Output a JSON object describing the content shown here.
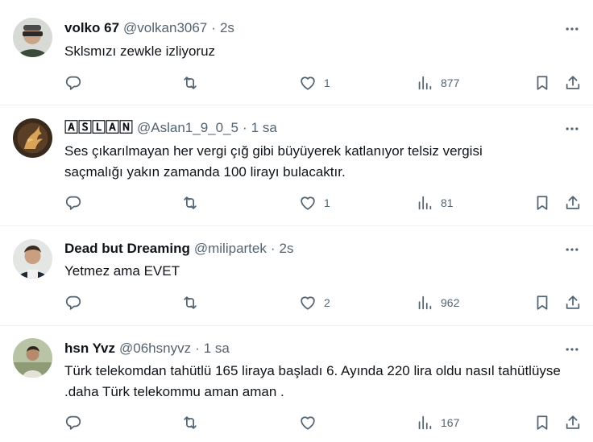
{
  "tweets": [
    {
      "name": "volko 67",
      "handle": "@volkan3067",
      "time": "2s",
      "text": "Sklsmızı zewkle izliyoruz",
      "likes": "1",
      "views": "877"
    },
    {
      "name": "🄰🅂🄻🄰🄽",
      "handle": "@Aslan1_9_0_5",
      "time": "1 sa",
      "text": "Ses çıkarılmayan her vergi çığ gibi büyüyerek katlanıyor telsiz vergisi saçmalığı yakın zamanda 100 lirayı bulacaktır.",
      "likes": "1",
      "views": "81"
    },
    {
      "name": "Dead but Dreaming",
      "handle": "@milipartek",
      "time": "2s",
      "text": "Yetmez ama EVET",
      "likes": "2",
      "views": "962"
    },
    {
      "name": "hsn Yvz",
      "handle": "@06hsnyvz",
      "time": "1 sa",
      "text": "Türk telekomdan tahütlü 165 liraya başladı 6. Ayında 220 lira oldu nasıl tahütlüyse .daha Türk telekommu aman aman .",
      "likes": "",
      "views": "167"
    }
  ],
  "separator": "·",
  "icons": {
    "reply": "reply-icon",
    "retweet": "retweet-icon",
    "like": "heart-icon",
    "views": "views-icon",
    "bookmark": "bookmark-icon",
    "share": "share-icon",
    "more": "more-icon"
  },
  "colors": {
    "text": "#0f1419",
    "secondary": "#536471",
    "divider": "#eff3f4"
  }
}
